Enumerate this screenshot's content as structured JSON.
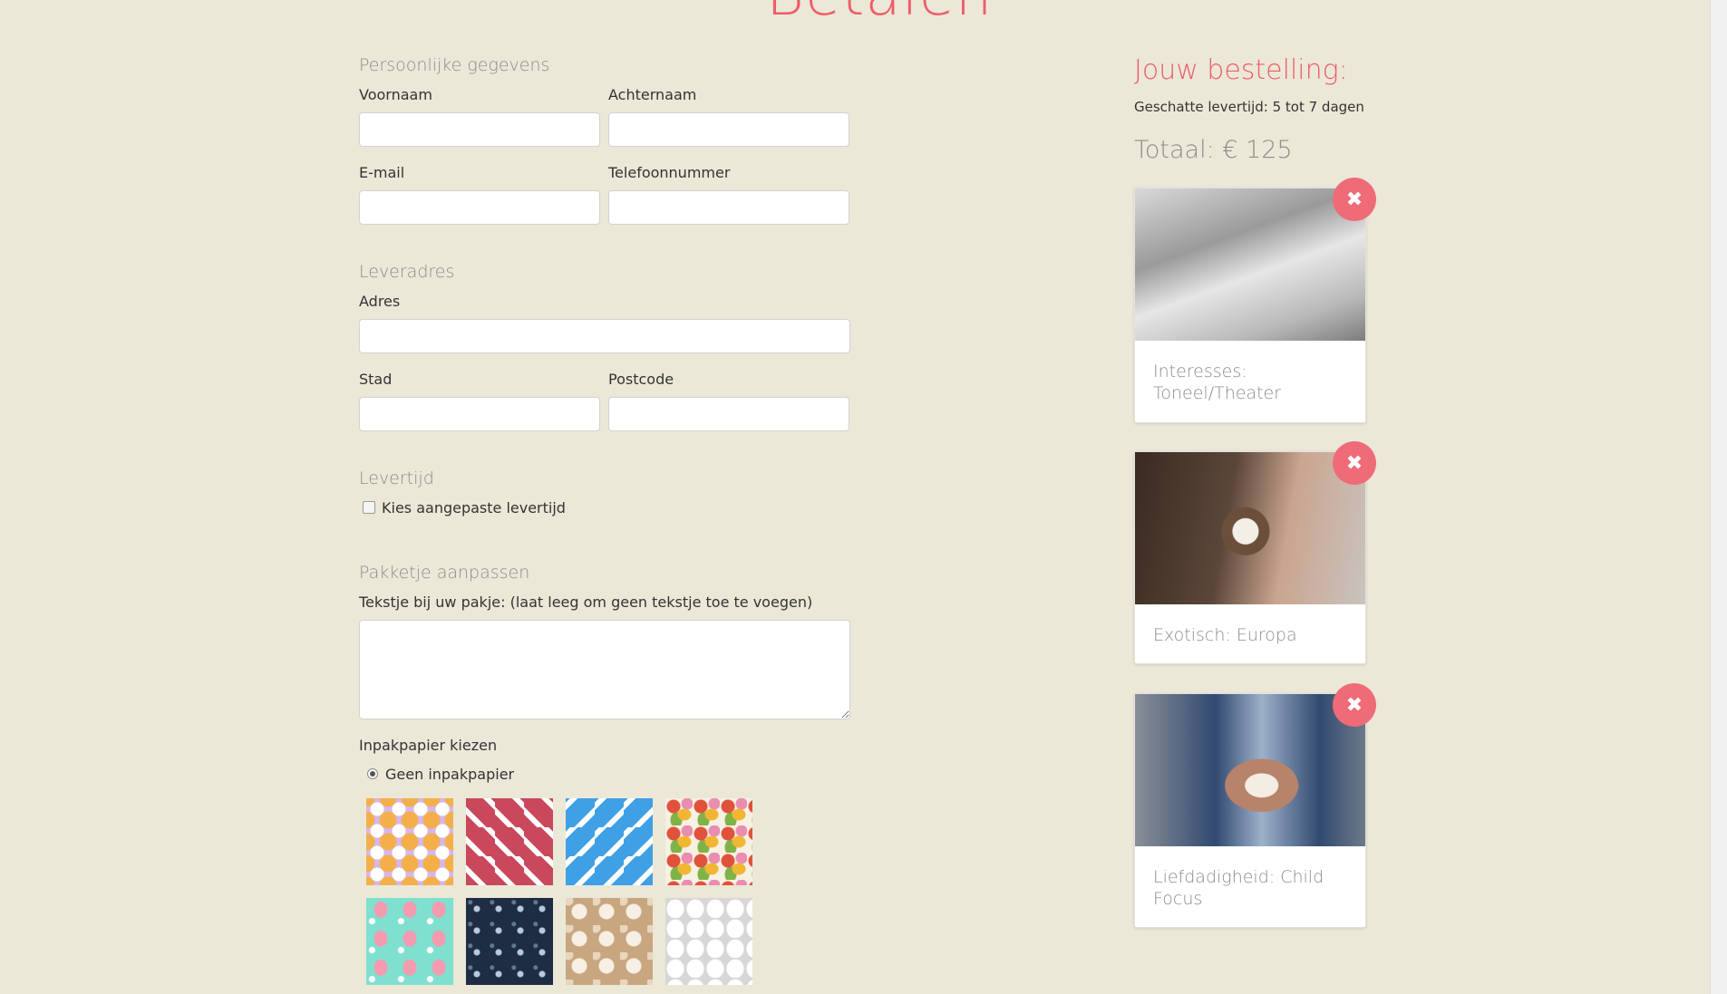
{
  "page": {
    "title": "Betalen"
  },
  "personal": {
    "heading": "Persoonlijke gegevens",
    "firstname_label": "Voornaam",
    "lastname_label": "Achternaam",
    "email_label": "E-mail",
    "phone_label": "Telefoonnummer"
  },
  "address": {
    "heading": "Leveradres",
    "address_label": "Adres",
    "city_label": "Stad",
    "postcode_label": "Postcode"
  },
  "delivery": {
    "heading": "Levertijd",
    "custom_label": "Kies aangepaste levertijd"
  },
  "package": {
    "heading": "Pakketje aanpassen",
    "message_label": "Tekstje bij uw pakje: (laat leeg om geen tekstje toe te voegen)",
    "wrapping_label": "Inpakpapier kiezen",
    "no_wrapping_label": "Geen inpakpapier"
  },
  "order": {
    "title": "Jouw bestelling:",
    "delivery_estimate": "Geschatte levertijd: 5 tot 7 dagen",
    "total": "Totaal: € 125",
    "remove_symbol": "✖",
    "items": [
      {
        "label": "Interesses: Toneel/Theater"
      },
      {
        "label": "Exotisch: Europa"
      },
      {
        "label": "Liefdadigheid: Child Focus"
      }
    ]
  }
}
